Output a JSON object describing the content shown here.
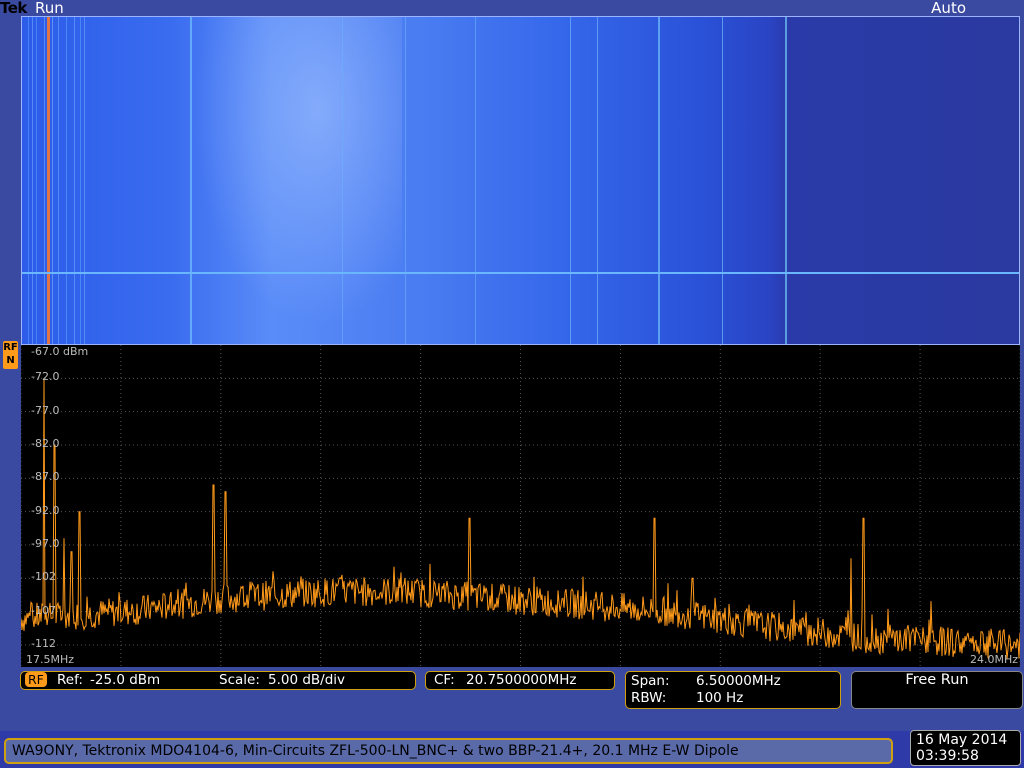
{
  "header": {
    "brand": "Tek",
    "acq_state": "Run",
    "trigger_mode": "Auto"
  },
  "rf_marker": {
    "line1": "RF",
    "line2": "N"
  },
  "settings": {
    "rf_tag": "RF",
    "ref_label": "Ref:",
    "ref_value": "-25.0 dBm",
    "scale_label": "Scale:",
    "scale_value": "5.00 dB/div",
    "cf_label": "CF:",
    "cf_value": "20.7500000MHz",
    "span_label": "Span:",
    "span_value": "6.50000MHz",
    "rbw_label": "RBW:",
    "rbw_value": "100 Hz",
    "mode": "Free Run"
  },
  "footer": {
    "note": "WA9ONY, Tektronix MDO4104-6, Min-Circuits ZFL-500-LN_BNC+ & two BBP-21.4+, 20.1 MHz E-W Dipole",
    "date": "16 May 2014",
    "time": "03:39:58"
  },
  "colors": {
    "trace": "#ff9a1a",
    "plot_bg": "#000000",
    "grid": "#555555",
    "accent": "#d0a010"
  },
  "chart_data": {
    "type": "line",
    "top_label": "-67.0 dBm",
    "y_tick_labels": [
      "-72.0",
      "-77.0",
      "-82.0",
      "-87.0",
      "-92.0",
      "-97.0",
      "-102",
      "-107",
      "-112"
    ],
    "y_ticks": [
      -72,
      -77,
      -82,
      -87,
      -92,
      -97,
      -102,
      -107,
      -112
    ],
    "x_start_label": "17.5MHz",
    "x_end_label": "24.0MHz",
    "xlim": [
      17.5,
      24.0
    ],
    "ylim": [
      -115.3,
      -67
    ],
    "grid": true,
    "unit_y": "dBm",
    "series": [
      {
        "color": "#ff9a1a",
        "noise_floor": [
          [
            17.5,
            -108
          ],
          [
            18.2,
            -107
          ],
          [
            18.8,
            -105
          ],
          [
            19.5,
            -104
          ],
          [
            20.0,
            -104
          ],
          [
            20.6,
            -105
          ],
          [
            21.2,
            -106
          ],
          [
            21.7,
            -107
          ],
          [
            22.3,
            -109
          ],
          [
            23.0,
            -111
          ],
          [
            24.0,
            -112
          ]
        ],
        "peaks": [
          [
            17.65,
            -72
          ],
          [
            17.72,
            -82
          ],
          [
            17.78,
            -96
          ],
          [
            17.88,
            -92
          ],
          [
            17.83,
            -98
          ],
          [
            18.75,
            -88
          ],
          [
            18.83,
            -89
          ],
          [
            20.42,
            -93
          ],
          [
            21.62,
            -93
          ],
          [
            21.87,
            -102
          ],
          [
            22.9,
            -99
          ],
          [
            22.98,
            -93
          ],
          [
            23.33,
            -110
          ],
          [
            23.75,
            -110
          ]
        ]
      }
    ]
  }
}
